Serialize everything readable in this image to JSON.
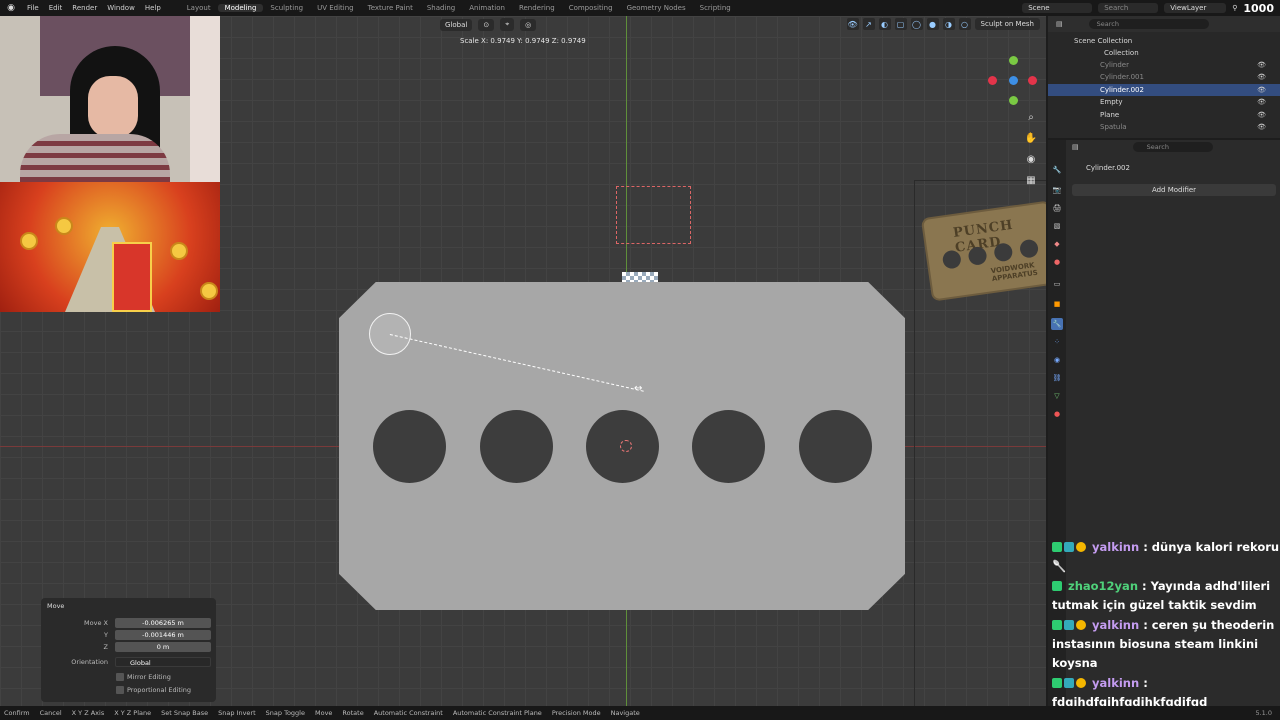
{
  "menubar": {
    "menus": [
      "File",
      "Edit",
      "Render",
      "Window",
      "Help"
    ],
    "workspaces": [
      "Layout",
      "Modeling",
      "Sculpting",
      "UV Editing",
      "Texture Paint",
      "Shading",
      "Animation",
      "Rendering",
      "Compositing",
      "Geometry Nodes",
      "Scripting"
    ],
    "active_workspace": "Modeling",
    "scene": "Scene",
    "search_placeholder": "Search",
    "view_layer": "ViewLayer",
    "viewer_count": "1000"
  },
  "viewport": {
    "orientation": "Global",
    "sculpt_label": "Sculpt on Mesh",
    "status_readout": "Scale X: 0.9749   Y: 0.9749   Z: 0.9749",
    "punch_card_title": "PUNCH CARD",
    "punch_card_sub": "VOIDWORK APPARATUS"
  },
  "operator_panel": {
    "title": "Move",
    "move_x_label": "Move X",
    "move_x": "-0.006265 m",
    "y_label": "Y",
    "y": "-0.001446 m",
    "z_label": "Z",
    "z": "0 m",
    "orientation_label": "Orientation",
    "orientation": "Global",
    "mirror": "Mirror Editing",
    "proportional": "Proportional Editing"
  },
  "statusbar": {
    "items": [
      "Confirm",
      "Cancel",
      "X Y Z Axis",
      "X Y Z Plane",
      "Set Snap Base",
      "Snap Invert",
      "Snap Toggle",
      "Move",
      "Rotate",
      "Automatic Constraint",
      "Automatic Constraint Plane",
      "Precision Mode",
      "Navigate"
    ],
    "version": "5.1.0"
  },
  "outliner": {
    "search_placeholder": "Search",
    "scene_collection": "Scene Collection",
    "collection": "Collection",
    "objects": [
      {
        "name": "Cylinder",
        "state": "dim"
      },
      {
        "name": "Cylinder.001",
        "state": "dim"
      },
      {
        "name": "Cylinder.002",
        "state": "selected"
      },
      {
        "name": "Empty",
        "state": "normal"
      },
      {
        "name": "Plane",
        "state": "normal"
      },
      {
        "name": "Spatula",
        "state": "dim"
      }
    ]
  },
  "properties": {
    "search_placeholder": "Search",
    "object_name": "Cylinder.002",
    "add_modifier": "Add Modifier"
  },
  "chat": {
    "messages": [
      {
        "user": "yalkinn",
        "text": ": dünya kalori rekoru",
        "extra": "🥄"
      },
      {
        "user": "zhao12yan",
        "text": ": Yayında adhd'lileri tutmak için güzel taktik sevdim"
      },
      {
        "user": "yalkinn",
        "text": ": ceren şu theoderin instasının biosuna steam linkini koysna"
      },
      {
        "user": "yalkinn",
        "text": ": fdgjhdfgjhfgdjhkfgdjfgd"
      }
    ]
  },
  "colors": {
    "selection": "#334d80",
    "accent_blue": "#4772b3",
    "plate": "#a7a7a7"
  }
}
